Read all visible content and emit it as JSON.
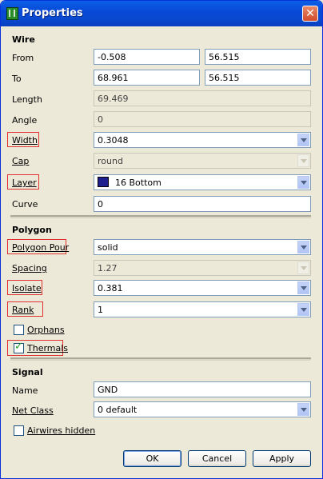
{
  "window": {
    "title": "Properties",
    "close_symbol": "✕"
  },
  "wire": {
    "section_title": "Wire",
    "from_label": "From",
    "from_x": "-0.508",
    "from_y": "56.515",
    "to_label": "To",
    "to_x": "68.961",
    "to_y": "56.515",
    "length_label": "Length",
    "length_value": "69.469",
    "angle_label": "Angle",
    "angle_value": "0",
    "width_label": "Width",
    "width_value": "0.3048",
    "cap_label": "Cap",
    "cap_value": "round",
    "layer_label": "Layer",
    "layer_value": "16 Bottom",
    "layer_color": "#1e1f8f",
    "curve_label": "Curve",
    "curve_value": "0"
  },
  "polygon": {
    "section_title": "Polygon",
    "pour_label": "Polygon Pour",
    "pour_value": "solid",
    "spacing_label": "Spacing",
    "spacing_value": "1.27",
    "isolate_label": "Isolate",
    "isolate_value": "0.381",
    "rank_label": "Rank",
    "rank_value": "1",
    "orphans_label": "Orphans",
    "orphans_checked": false,
    "thermals_label": "Thermals",
    "thermals_checked": true
  },
  "signal": {
    "section_title": "Signal",
    "name_label": "Name",
    "name_value": "GND",
    "netclass_label": "Net Class",
    "netclass_value": "0 default",
    "airwires_label": "Airwires hidden",
    "airwires_checked": false
  },
  "buttons": {
    "ok": "OK",
    "cancel": "Cancel",
    "apply": "Apply"
  },
  "highlight_color": "#e03030"
}
